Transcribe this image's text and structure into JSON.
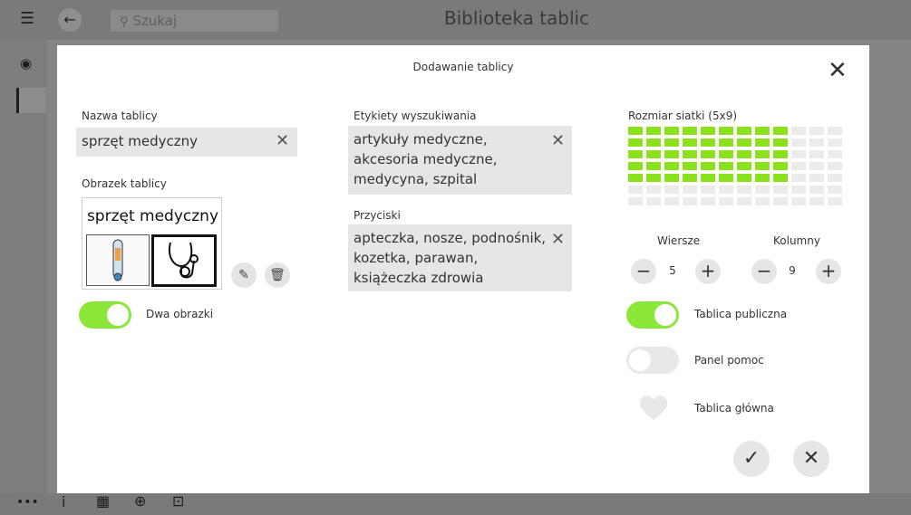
{
  "app": {
    "title": "Biblioteka tablic",
    "search_placeholder": "Szukaj",
    "icons": [
      "hamburger-icon",
      "back-icon",
      "search-icon",
      "eye-icon",
      "more-icon",
      "info-icon",
      "add-board-icon",
      "add-page-icon",
      "export-icon"
    ]
  },
  "dialog": {
    "title": "Dodawanie tablicy",
    "name": {
      "label": "Nazwa tablicy",
      "value": "sprzęt medyczny"
    },
    "image": {
      "label": "Obrazek tablicy",
      "card_title": "sprzęt medyczny",
      "images": [
        "thermometer-picture",
        "stethoscope-picture"
      ]
    },
    "two_images": {
      "label": "Dwa obrazki",
      "on": true
    },
    "tags": {
      "label": "Etykiety wyszukiwania",
      "lines": [
        "artykuły medyczne,",
        "akcesoria medyczne,",
        "medycyna, szpital"
      ]
    },
    "buttons": {
      "label": "Przyciski",
      "lines": [
        "apteczka, nosze, podnośnik,",
        "kozetka, parawan,",
        "książeczka zdrowia"
      ]
    },
    "grid_size": {
      "label": "Rozmiar siatki (5x9)",
      "rows": 5,
      "cols": 9,
      "total_rows": 7,
      "total_cols": 12,
      "selected_color": "#8be11b",
      "empty_color": "#ebebeb"
    },
    "rows_stepper": {
      "label": "Wiersze",
      "value": "5"
    },
    "cols_stepper": {
      "label": "Kolumny",
      "value": "9"
    },
    "public_board": {
      "label": "Tablica publiczna",
      "on": true
    },
    "help_panel": {
      "label": "Panel pomoc",
      "on": false
    },
    "main_board": {
      "label": "Tablica główna"
    },
    "accent_color": "#8be83a"
  }
}
